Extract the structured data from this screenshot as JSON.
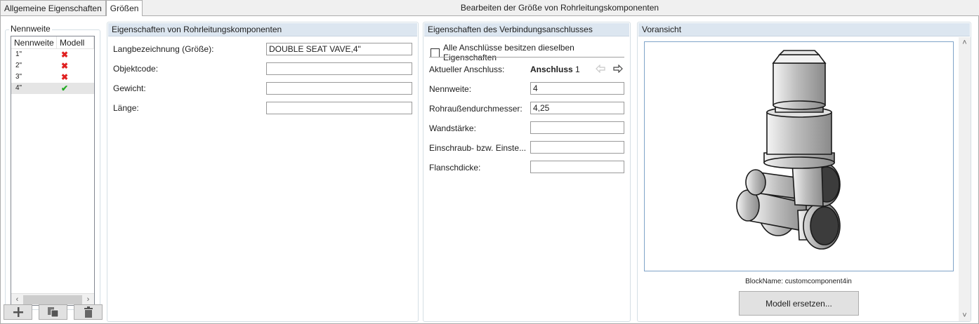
{
  "tabs": [
    {
      "label": "Allgemeine Eigenschaften",
      "active": false
    },
    {
      "label": "Größen",
      "active": true
    }
  ],
  "window_title": "Bearbeiten der Größe von Rohrleitungskomponenten",
  "nennweite_group": {
    "title": "Nennweite",
    "columns": [
      "Nennweite",
      "Modell"
    ],
    "rows": [
      {
        "size": "1\"",
        "model": "✖",
        "status": "missing"
      },
      {
        "size": "2\"",
        "model": "✖",
        "status": "missing"
      },
      {
        "size": "3\"",
        "model": "✖",
        "status": "missing"
      },
      {
        "size": "4\"",
        "model": "✔",
        "status": "ok",
        "selected": true
      }
    ]
  },
  "toolbar": {
    "add_icon": "plus-icon",
    "copy_icon": "copy-icon",
    "delete_icon": "trash-icon"
  },
  "component_props": {
    "title": "Eigenschaften von Rohrleitungskomponenten",
    "fields": [
      {
        "label": "Langbezeichnung (Größe):",
        "value": "DOUBLE SEAT VAVE,4\""
      },
      {
        "label": "Objektcode:",
        "value": ""
      },
      {
        "label": "Gewicht:",
        "value": ""
      },
      {
        "label": "Länge:",
        "value": ""
      }
    ]
  },
  "connection_props": {
    "title": "Eigenschaften des Verbindungsanschlusses",
    "same_props_checkbox": {
      "label": "Alle Anschlüsse besitzen dieselben Eigenschaften",
      "checked": false
    },
    "current_label": "Aktueller Anschluss:",
    "current_name": "Anschluss",
    "current_number": "1",
    "fields": [
      {
        "label": "Nennweite:",
        "value": "4"
      },
      {
        "label": "Rohraußendurchmesser:",
        "value": "4,25"
      },
      {
        "label": "Wandstärke:",
        "value": ""
      },
      {
        "label": "Einschraub- bzw. Einste...",
        "value": ""
      },
      {
        "label": "Flanschdicke:",
        "value": ""
      }
    ]
  },
  "preview": {
    "title": "Voransicht",
    "blockname": "BlockName: customcomponent4in",
    "replace_button": "Modell ersetzen..."
  },
  "colors": {
    "header_bg": "#dce6f0",
    "missing": "#e02020",
    "ok": "#22aa22"
  }
}
